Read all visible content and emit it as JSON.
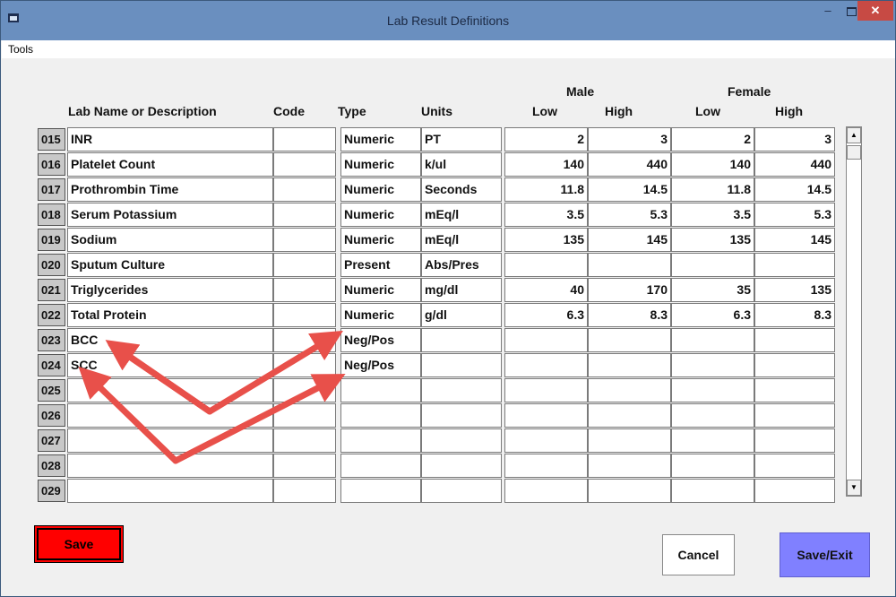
{
  "window": {
    "title": "Lab Result Definitions",
    "minimize_glyph": "–",
    "close_glyph": "✕"
  },
  "menu": {
    "tools": "Tools"
  },
  "headers": {
    "lab_name": "Lab Name or Description",
    "code": "Code",
    "type": "Type",
    "units": "Units",
    "male": "Male",
    "female": "Female",
    "male_low": "Low",
    "male_high": "High",
    "female_low": "Low",
    "female_high": "High"
  },
  "rows": [
    {
      "num": "015",
      "name": "INR",
      "code": "",
      "type": "Numeric",
      "units": "PT",
      "male_low": "2",
      "male_high": "3",
      "female_low": "2",
      "female_high": "3"
    },
    {
      "num": "016",
      "name": "Platelet Count",
      "code": "",
      "type": "Numeric",
      "units": "k/ul",
      "male_low": "140",
      "male_high": "440",
      "female_low": "140",
      "female_high": "440"
    },
    {
      "num": "017",
      "name": "Prothrombin Time",
      "code": "",
      "type": "Numeric",
      "units": "Seconds",
      "male_low": "11.8",
      "male_high": "14.5",
      "female_low": "11.8",
      "female_high": "14.5"
    },
    {
      "num": "018",
      "name": "Serum Potassium",
      "code": "",
      "type": "Numeric",
      "units": "mEq/l",
      "male_low": "3.5",
      "male_high": "5.3",
      "female_low": "3.5",
      "female_high": "5.3"
    },
    {
      "num": "019",
      "name": "Sodium",
      "code": "",
      "type": "Numeric",
      "units": "mEq/l",
      "male_low": "135",
      "male_high": "145",
      "female_low": "135",
      "female_high": "145"
    },
    {
      "num": "020",
      "name": "Sputum Culture",
      "code": "",
      "type": "Present",
      "units": "Abs/Pres",
      "male_low": "",
      "male_high": "",
      "female_low": "",
      "female_high": ""
    },
    {
      "num": "021",
      "name": "Triglycerides",
      "code": "",
      "type": "Numeric",
      "units": "mg/dl",
      "male_low": "40",
      "male_high": "170",
      "female_low": "35",
      "female_high": "135"
    },
    {
      "num": "022",
      "name": "Total Protein",
      "code": "",
      "type": "Numeric",
      "units": "g/dl",
      "male_low": "6.3",
      "male_high": "8.3",
      "female_low": "6.3",
      "female_high": "8.3"
    },
    {
      "num": "023",
      "name": "BCC",
      "code": "",
      "type": "Neg/Pos",
      "units": "",
      "male_low": "",
      "male_high": "",
      "female_low": "",
      "female_high": ""
    },
    {
      "num": "024",
      "name": "SCC",
      "code": "",
      "type": "Neg/Pos",
      "units": "",
      "male_low": "",
      "male_high": "",
      "female_low": "",
      "female_high": ""
    },
    {
      "num": "025",
      "name": "",
      "code": "",
      "type": "",
      "units": "",
      "male_low": "",
      "male_high": "",
      "female_low": "",
      "female_high": ""
    },
    {
      "num": "026",
      "name": "",
      "code": "",
      "type": "",
      "units": "",
      "male_low": "",
      "male_high": "",
      "female_low": "",
      "female_high": ""
    },
    {
      "num": "027",
      "name": "",
      "code": "",
      "type": "",
      "units": "",
      "male_low": "",
      "male_high": "",
      "female_low": "",
      "female_high": ""
    },
    {
      "num": "028",
      "name": "",
      "code": "",
      "type": "",
      "units": "",
      "male_low": "",
      "male_high": "",
      "female_low": "",
      "female_high": ""
    },
    {
      "num": "029",
      "name": "",
      "code": "",
      "type": "",
      "units": "",
      "male_low": "",
      "male_high": "",
      "female_low": "",
      "female_high": ""
    }
  ],
  "buttons": {
    "save": "Save",
    "cancel": "Cancel",
    "save_exit": "Save/Exit"
  },
  "colors": {
    "save_button": "#ff0000",
    "save_exit_button": "#8080ff",
    "annotation_arrow": "#e8504a"
  },
  "icons": {
    "scroll_up": "▲",
    "scroll_down": "▼"
  }
}
